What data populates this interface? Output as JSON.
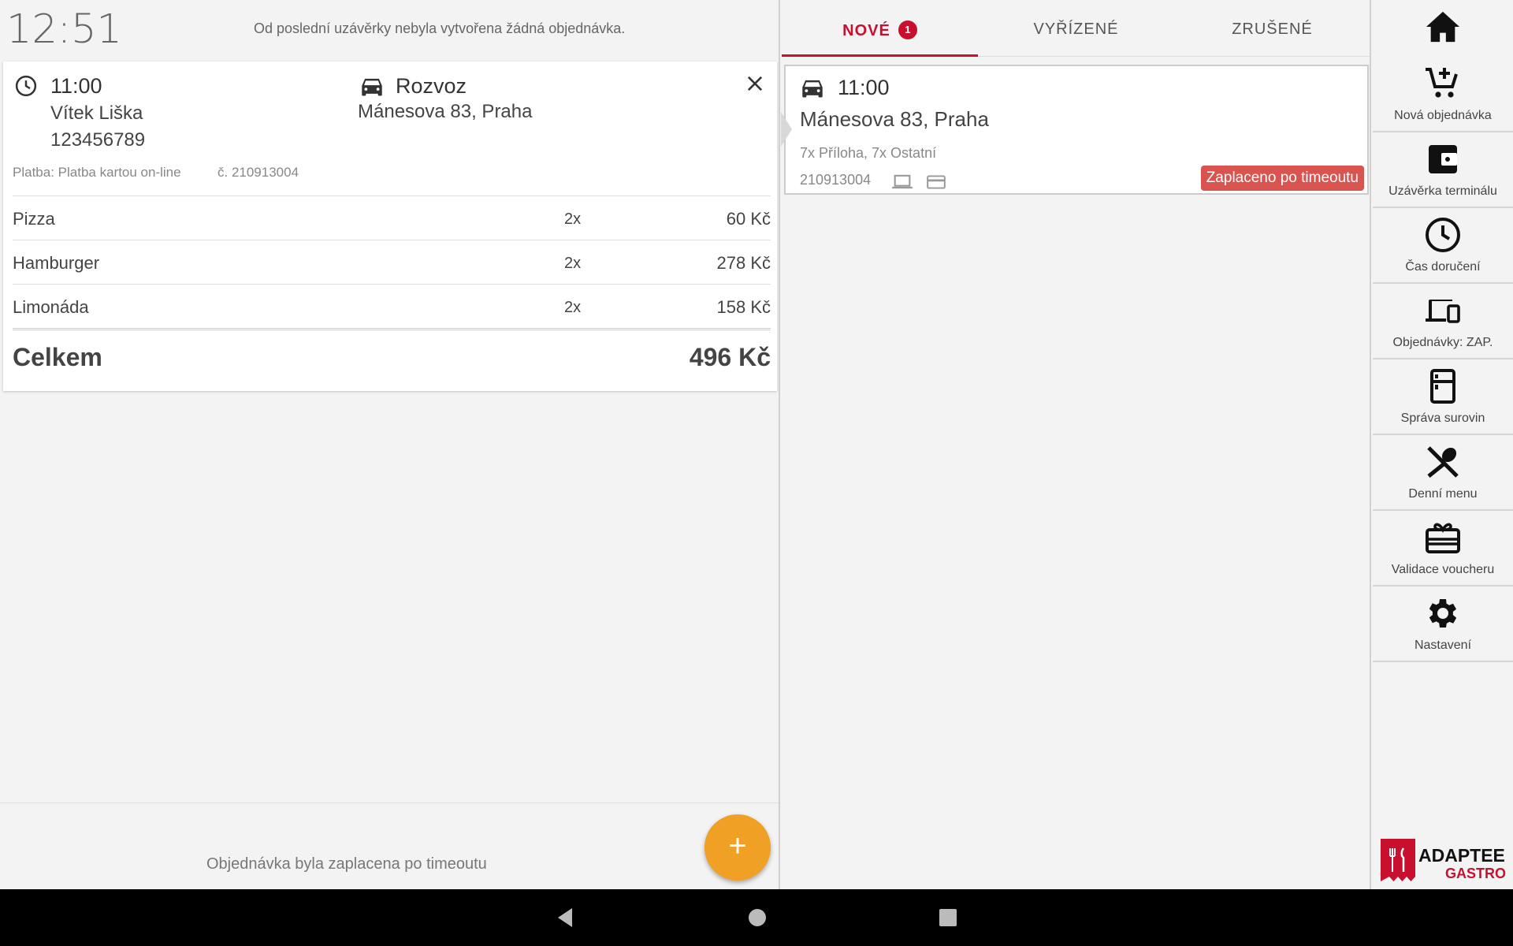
{
  "status": {
    "clock": "12:51",
    "info": "Od poslední uzávěrky nebyla vytvořena žádná objednávka."
  },
  "order_detail": {
    "time": "11:00",
    "customer_name": "Vítek Liška",
    "phone": "123456789",
    "delivery_type": "Rozvoz",
    "address": "Mánesova 83, Praha",
    "payment": "Platba: Platba kartou on-line",
    "order_number": "č. 210913004",
    "items": [
      {
        "name": "Pizza",
        "qty": "2x",
        "price": "60 Kč"
      },
      {
        "name": "Hamburger",
        "qty": "2x",
        "price": "278 Kč"
      },
      {
        "name": "Limonáda",
        "qty": "2x",
        "price": "158 Kč"
      }
    ],
    "total_label": "Celkem",
    "total_value": "496 Kč"
  },
  "bottom": {
    "message": "Objednávka byla zaplacena po timeoutu",
    "fab_label": "+"
  },
  "tabs": [
    {
      "label": "NOVÉ",
      "badge": "1",
      "active": true
    },
    {
      "label": "VYŘÍZENÉ"
    },
    {
      "label": "ZRUŠENÉ"
    }
  ],
  "order_list": [
    {
      "time": "11:00",
      "address": "Mánesova 83, Praha",
      "summary": "7x Příloha, 7x Ostatní",
      "number": "210913004",
      "status_badge": "Zaplaceno po timeoutu"
    }
  ],
  "sidebar": {
    "items": [
      {
        "label": "Nová objednávka",
        "icon": "cart-add-icon"
      },
      {
        "label": "Uzávěrka terminálu",
        "icon": "wallet-icon"
      },
      {
        "label": "Čas doručení",
        "icon": "clock-icon"
      },
      {
        "label": "Objednávky: ZAP.",
        "icon": "devices-icon"
      },
      {
        "label": "Správa surovin",
        "icon": "fridge-icon"
      },
      {
        "label": "Denní menu",
        "icon": "utensils-icon"
      },
      {
        "label": "Validace voucheru",
        "icon": "gift-card-icon"
      },
      {
        "label": "Nastavení",
        "icon": "gear-icon"
      }
    ],
    "logo_top": "ADAPTEE",
    "logo_bottom": "GASTRO"
  },
  "colors": {
    "accent": "#c8102e",
    "fab": "#f0a025",
    "status_badge": "#d9534f"
  }
}
